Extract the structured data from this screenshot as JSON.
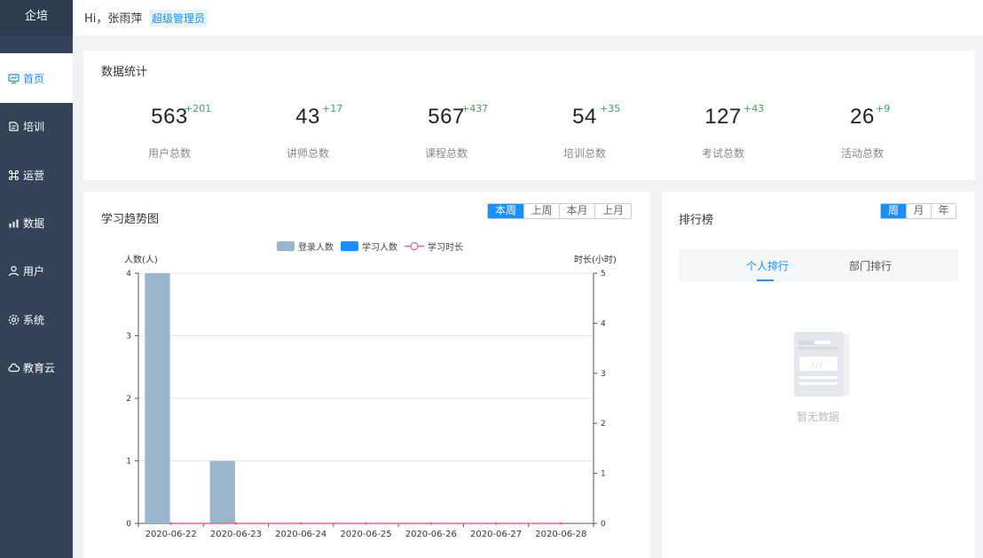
{
  "app": {
    "title": "企培"
  },
  "sidebar": {
    "items": [
      {
        "label": "首页",
        "icon": "monitor-icon",
        "active": true
      },
      {
        "label": "培训",
        "icon": "book-icon",
        "active": false
      },
      {
        "label": "运营",
        "icon": "command-icon",
        "active": false
      },
      {
        "label": "数据",
        "icon": "chart-bars-icon",
        "active": false
      },
      {
        "label": "用户",
        "icon": "user-icon",
        "active": false
      },
      {
        "label": "系统",
        "icon": "gear-icon",
        "active": false
      },
      {
        "label": "教育云",
        "icon": "cloud-icon",
        "active": false
      }
    ]
  },
  "header": {
    "greeting": "Hi，张雨萍",
    "role": "超级管理员"
  },
  "stats": {
    "title": "数据统计",
    "items": [
      {
        "value": "563",
        "delta": "+201",
        "label": "用户总数"
      },
      {
        "value": "43",
        "delta": "+17",
        "label": "讲师总数"
      },
      {
        "value": "567",
        "delta": "+437",
        "label": "课程总数"
      },
      {
        "value": "54",
        "delta": "+35",
        "label": "培训总数"
      },
      {
        "value": "127",
        "delta": "+43",
        "label": "考试总数"
      },
      {
        "value": "26",
        "delta": "+9",
        "label": "活动总数"
      }
    ]
  },
  "trend": {
    "title": "学习趋势图",
    "ranges": [
      "本周",
      "上周",
      "本月",
      "上月"
    ],
    "selected_range": "本周"
  },
  "chart_data": {
    "type": "bar",
    "categories": [
      "2020-06-22",
      "2020-06-23",
      "2020-06-24",
      "2020-06-25",
      "2020-06-26",
      "2020-06-27",
      "2020-06-28"
    ],
    "series": [
      {
        "name": "登录人数",
        "type": "bar",
        "axis": "left",
        "color": "#9bb6cc",
        "values": [
          4,
          1,
          0,
          0,
          0,
          0,
          0
        ]
      },
      {
        "name": "学习人数",
        "type": "bar",
        "axis": "left",
        "color": "#1890ff",
        "values": [
          0,
          0,
          0,
          0,
          0,
          0,
          0
        ]
      },
      {
        "name": "学习时长",
        "type": "line",
        "axis": "right",
        "color": "#f06292",
        "values": [
          0,
          0,
          0,
          0,
          0,
          0,
          0
        ]
      }
    ],
    "ylabel": "人数(人)",
    "ylim": [
      0,
      4
    ],
    "yticks": [
      "0",
      "1",
      "2",
      "3",
      "4"
    ],
    "y2label": "时长(小时)",
    "y2lim": [
      0,
      5
    ],
    "y2ticks": [
      "0",
      "1",
      "2",
      "3",
      "4",
      "5"
    ],
    "grid": true,
    "legend_position": "top"
  },
  "ranking": {
    "title": "排行榜",
    "periods": [
      "周",
      "月",
      "年"
    ],
    "selected_period": "周",
    "tabs": [
      "个人排行",
      "部门排行"
    ],
    "active_tab": "个人排行",
    "empty_text": "暂无数据"
  }
}
